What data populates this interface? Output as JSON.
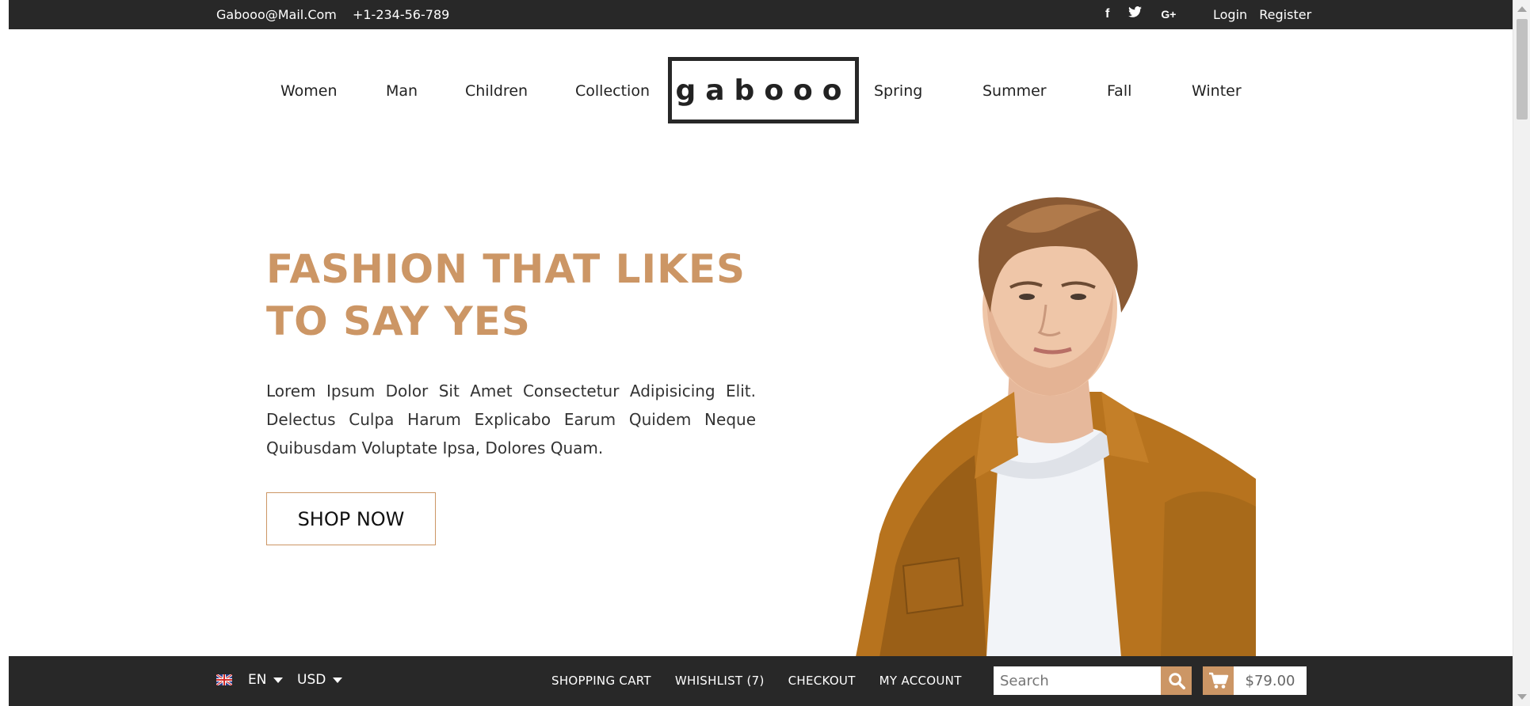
{
  "topbar": {
    "email": "Gabooo@Mail.Com",
    "phone": "+1-234-56-789",
    "social": [
      {
        "icon": "facebook-icon",
        "glyph": "f"
      },
      {
        "icon": "twitter-icon",
        "glyph": "t"
      },
      {
        "icon": "google-plus-icon",
        "glyph": "G+"
      }
    ],
    "login_label": "Login",
    "register_label": "Register"
  },
  "nav": {
    "left_items": [
      "Women",
      "Man",
      "Children",
      "Collection"
    ],
    "right_items": [
      "Spring",
      "Summer",
      "Fall",
      "Winter"
    ],
    "logo_text": "gabooo"
  },
  "hero": {
    "title": "FASHION THAT LIKES TO SAY YES",
    "text": "Lorem Ipsum Dolor Sit Amet Consectetur Adipisicing Elit. Delectus Culpa Harum Explicabo Earum Quidem Neque Quibusdam Voluptate Ipsa, Dolores Quam.",
    "cta_label": "SHOP NOW"
  },
  "bottombar": {
    "language": "EN",
    "currency": "USD",
    "links": [
      "SHOPPING CART",
      "WHISHLIST (7)",
      "CHECKOUT",
      "MY ACCOUNT"
    ],
    "search_placeholder": "Search",
    "cart_total": "$79.00"
  },
  "colors": {
    "accent": "#cc9665",
    "dark_bar": "#282828"
  }
}
